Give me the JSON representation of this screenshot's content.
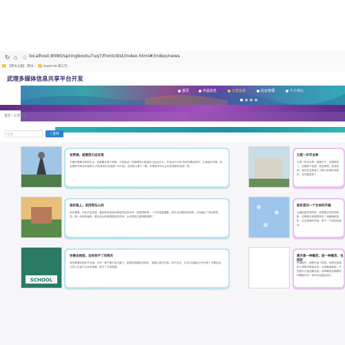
{
  "browser": {
    "url": "localhost:8080/springbootu7uq7/front/dist/index.html#/index/news",
    "bookmarks": [
      "【苏州之旅】 苏州...",
      "Day02-09-第三行..."
    ]
  },
  "site": {
    "title": "武理多媒体信息共享平台开发"
  },
  "nav": {
    "items": [
      {
        "label": "首页",
        "active": false
      },
      {
        "label": "作品信息",
        "active": false
      },
      {
        "label": "公告信息",
        "active": true
      },
      {
        "label": "后台管理",
        "active": false
      },
      {
        "label": "个人中心",
        "active": false
      }
    ]
  },
  "breadcrumb": {
    "home": "首页",
    "sep": "/",
    "current": "公告信息"
  },
  "search": {
    "placeholder": "标题",
    "button": "查询"
  },
  "colors": {
    "accent": "#2f7fd8",
    "active_menu": "#f0d240",
    "card_left": "#b8e6e8",
    "card_right": "#e9c4ee"
  },
  "news": [
    {
      "title": "有梦想，就要努力去实现",
      "text": "不管你想要怎样的生活，你都要去努力争取，不多尝试一些事情怎么知道自己适合什么，不适合什么呢?你说你喜欢读书，让我给你书单，你还是把书单当作装修去了吧!其实你也就是一时兴起，在网络上看了一眼，好像读书可以让你变得很有品味一样。"
    },
    {
      "title": "又是一年毕业季",
      "text": "又是一年毕业季，感慨万千，还是那些人，还是那个校园，依旧美丽，依旧热闹，我们在这里留下了那么多美好的回忆，如今要告别了……"
    },
    {
      "title": "挫折路上，坚持常在心间",
      "text": "回头看看，你会不会发现，曾经的你会因为眼前的这些坎坷，而显得犹豫，一次次地摇摆着，或许当初是你的犹豫，让你错过了成功的机会；那一刻你的疲惫，是否会为你赢得更多的时间，让你把自己看得更清楚？"
    },
    {
      "title": "挫折是另一个生命的开端",
      "text": "当遇到挫折或失败，你是看见失败的阴影，还是看见希望的阳光？而困难和挫折，往往是新的开始，是下一个成功的起点。"
    },
    {
      "title": "你要去相信，没有到不了的明天",
      "text": "有些事情你现在不去做，也许一辈子都不会去做了。如果你想要改变现状，就要从现在开始。你不去试，又怎么知道自己不行呢？不要给自己的人生留下太多的遗憾，努力了才有希望。"
    },
    {
      "title": "离开是一种痛苦，放一种痛苦，也挺好",
      "text": "所谓离开，就是在某个时刻，你意识到某些人或事不再适合你，与其勉强维持，不如放手让彼此都自由。这种痛苦会随着时间慢慢淡去，而你也会因此成长。"
    }
  ]
}
